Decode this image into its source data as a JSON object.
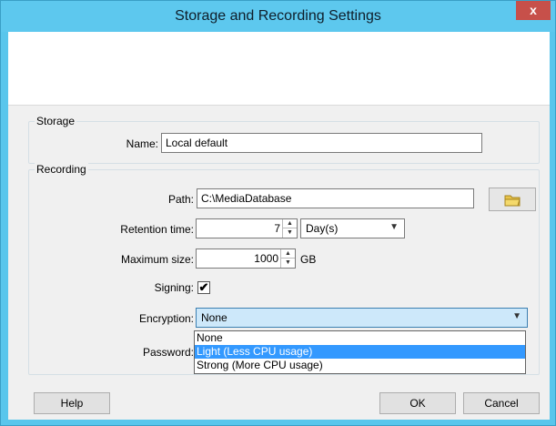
{
  "window": {
    "title": "Storage and Recording Settings",
    "close_label": "x"
  },
  "storage": {
    "group_label": "Storage",
    "name_label": "Name:",
    "name_value": "Local default"
  },
  "recording": {
    "group_label": "Recording",
    "path_label": "Path:",
    "path_value": "C:\\MediaDatabase",
    "retention_label": "Retention time:",
    "retention_value": "7",
    "retention_unit": "Day(s)",
    "max_size_label": "Maximum size:",
    "max_size_value": "1000",
    "max_size_unit": "GB",
    "signing_label": "Signing:",
    "signing_checked": true,
    "encryption_label": "Encryption:",
    "encryption_value": "None",
    "encryption_options": [
      "None",
      "Light (Less CPU usage)",
      "Strong (More CPU usage)"
    ],
    "password_label": "Password:"
  },
  "buttons": {
    "help": "Help",
    "ok": "OK",
    "cancel": "Cancel"
  },
  "icons": {
    "browse": "folder-icon",
    "check": "checkmark-icon"
  }
}
